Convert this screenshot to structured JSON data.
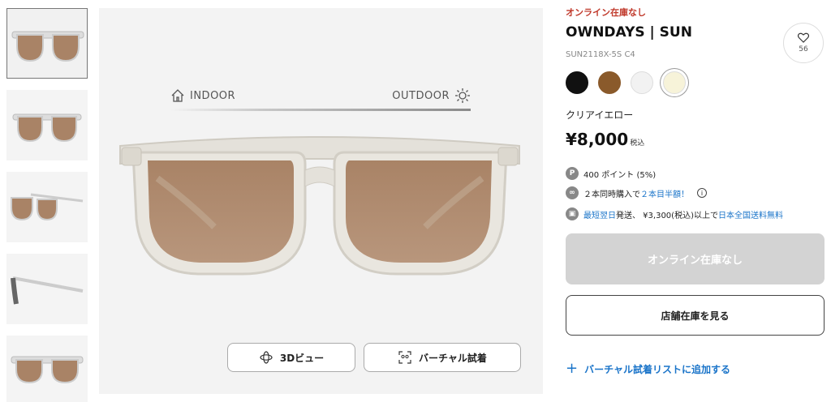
{
  "thumbnails": [
    {
      "view": "front"
    },
    {
      "view": "front-angled"
    },
    {
      "view": "three-quarter"
    },
    {
      "view": "side"
    },
    {
      "view": "front-low"
    }
  ],
  "viewer": {
    "indoor_label": "INDOOR",
    "outdoor_label": "OUTDOOR",
    "btn_3d_label": "3Dビュー",
    "btn_virtual_label": "バーチャル試着"
  },
  "product": {
    "stock_alert": "オンライン在庫なし",
    "brand": "OWNDAYS | SUN",
    "model": "SUN2118X-5S C4",
    "favorite_count": "56",
    "swatches": [
      {
        "color": "#111111",
        "selected": false
      },
      {
        "color": "#8a5a2b",
        "selected": false
      },
      {
        "color": "#f2f2f2",
        "selected": false
      },
      {
        "color": "#f7f3d9",
        "selected": true
      }
    ],
    "color_name": "クリアイエロー",
    "price": "¥8,000",
    "tax_label": "税込"
  },
  "perks": {
    "points_icon": "P",
    "points_text": "400 ポイント (5%)",
    "bundle_text_prefix": "２本同時購入で",
    "bundle_link": "２本目半額！",
    "shipping_link1": "最短翌日",
    "shipping_text_mid": "発送、 ¥3,300(税込)以上で",
    "shipping_link2": "日本全国送料無料"
  },
  "actions": {
    "online_soldout": "オンライン在庫なし",
    "store_stock": "店舗在庫を見る",
    "add_virtual_list": "バーチャル試着リストに追加する"
  },
  "colors": {
    "accent_link": "#1a74c9",
    "alert_red": "#c0392b",
    "lens_brown": "#a98366",
    "frame_clear": "#e4e1da"
  }
}
